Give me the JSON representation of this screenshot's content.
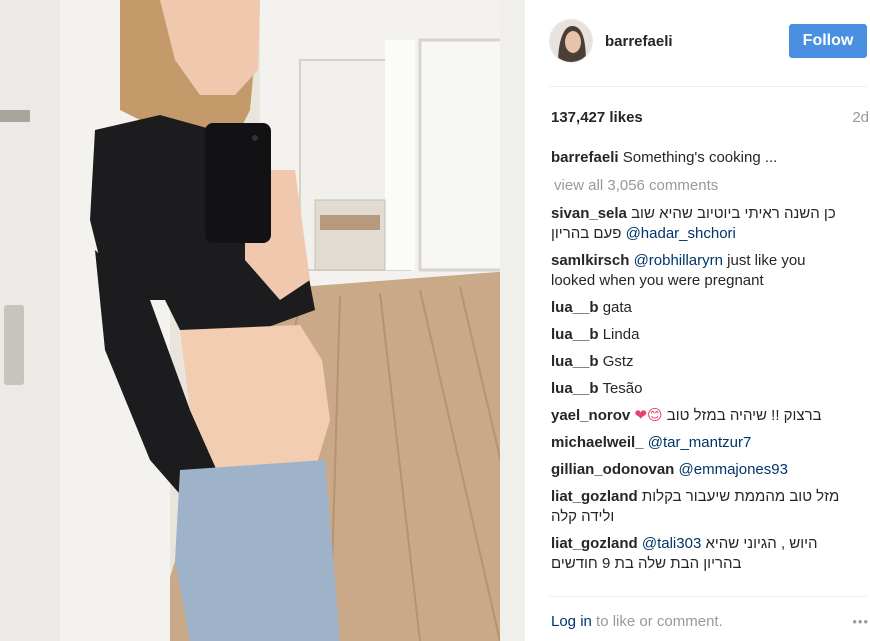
{
  "post": {
    "photo_alt": "pregnant woman taking mirror selfie"
  },
  "header": {
    "username": "barrefaeli",
    "follow_label": "Follow"
  },
  "stats": {
    "likes": "137,427 likes",
    "age": "2d"
  },
  "caption": {
    "user": "barrefaeli",
    "text": "Something's cooking ..."
  },
  "view_all": "view all 3,056 comments",
  "comments": [
    {
      "user": "sivan_sela",
      "text": "כן השנה ראיתי ביוטיוב שהיא שוב פעם בהריון",
      "mention": "@hadar_shchori"
    },
    {
      "user": "samlkirsch",
      "mention": "@robhillaryrn",
      "text": "just like you looked when you were pregnant"
    },
    {
      "user": "lua__b",
      "text": "gata"
    },
    {
      "user": "lua__b",
      "text": "Linda"
    },
    {
      "user": "lua__b",
      "text": "Gstz"
    },
    {
      "user": "lua__b",
      "text": "Tesão"
    },
    {
      "user": "yael_norov",
      "text": "ברצוק !! שיהיה במזל טוב",
      "emoji": "❤😊"
    },
    {
      "user": "michaelweil_",
      "mention": "@tar_mantzur7"
    },
    {
      "user": "gillian_odonovan",
      "mention": "@emmajones93"
    },
    {
      "user": "liat_gozland",
      "text": "מזל טוב מהממת שיעבור בקלות ולידה קלה"
    },
    {
      "user": "liat_gozland",
      "mention": "@tali303",
      "text": "היוש , הגיוני שהיא בהריון הבת שלה בת 9 חודשים"
    }
  ],
  "footer": {
    "login_label": "Log in",
    "login_rest": "to like or comment.",
    "more_icon": "•••"
  },
  "colors": {
    "follow_bg": "#4a90e2",
    "link": "#003569",
    "muted": "#999999"
  }
}
